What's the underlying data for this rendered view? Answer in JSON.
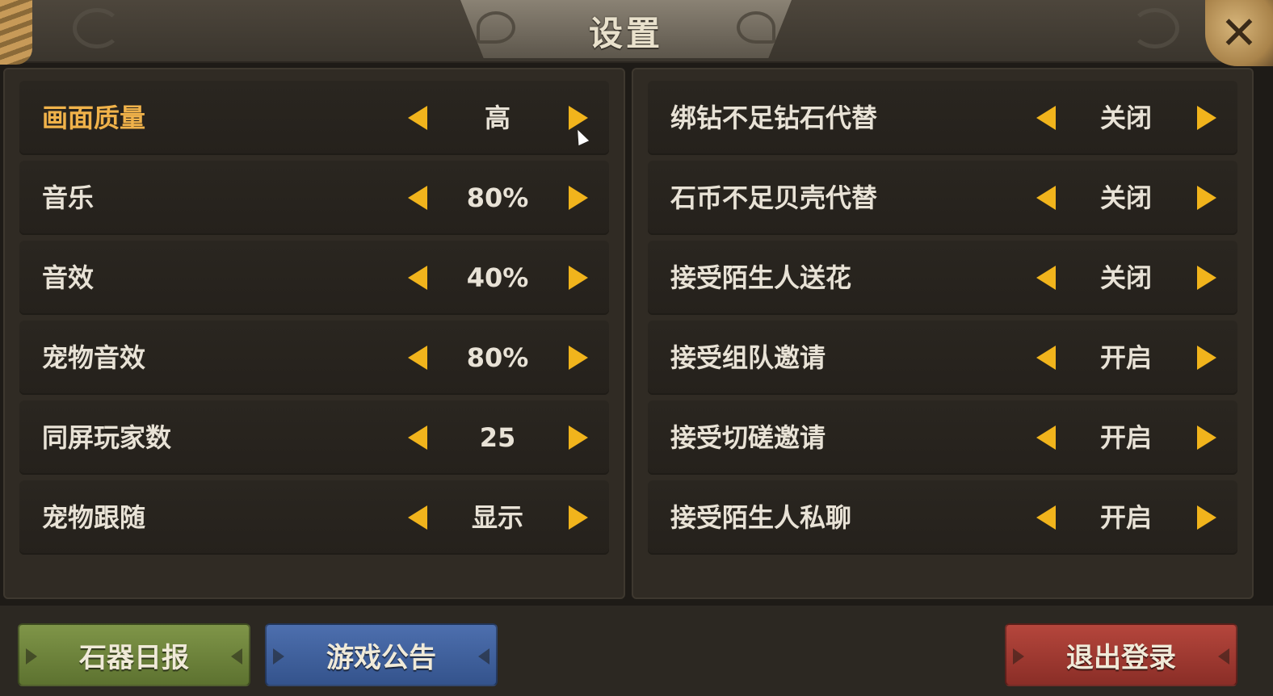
{
  "title": "设置",
  "close_icon": "close-icon",
  "left_settings": [
    {
      "label": "画面质量",
      "value": "高"
    },
    {
      "label": "音乐",
      "value": "80%"
    },
    {
      "label": "音效",
      "value": "40%"
    },
    {
      "label": "宠物音效",
      "value": "80%"
    },
    {
      "label": "同屏玩家数",
      "value": "25"
    },
    {
      "label": "宠物跟随",
      "value": "显示"
    }
  ],
  "right_settings": [
    {
      "label": "绑钻不足钻石代替",
      "value": "关闭"
    },
    {
      "label": "石币不足贝壳代替",
      "value": "关闭"
    },
    {
      "label": "接受陌生人送花",
      "value": "关闭"
    },
    {
      "label": "接受组队邀请",
      "value": "开启"
    },
    {
      "label": "接受切磋邀请",
      "value": "开启"
    },
    {
      "label": "接受陌生人私聊",
      "value": "开启"
    }
  ],
  "buttons": {
    "daily_report": "石器日报",
    "announcement": "游戏公告",
    "logout": "退出登录"
  },
  "colors": {
    "accent_arrow": "#f1b41c",
    "highlight_label": "#f0b24a",
    "green_button": "#6e8440",
    "blue_button": "#40609c",
    "red_button": "#a03a32"
  }
}
